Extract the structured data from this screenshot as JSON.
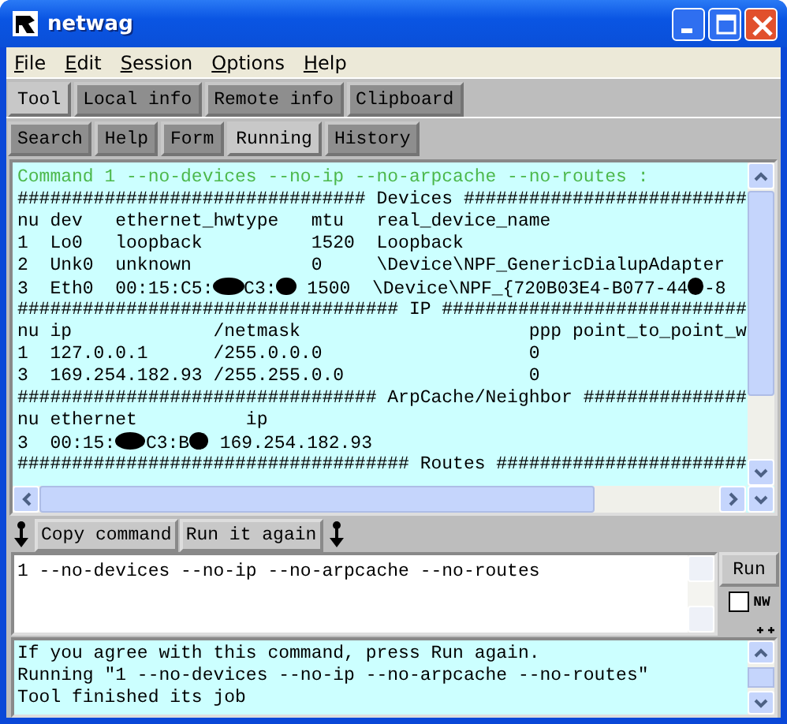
{
  "window": {
    "title": "netwag"
  },
  "menu": [
    {
      "label": "File"
    },
    {
      "label": "Edit"
    },
    {
      "label": "Session"
    },
    {
      "label": "Options"
    },
    {
      "label": "Help"
    }
  ],
  "main_tabs": [
    {
      "label": "Tool",
      "selected": true
    },
    {
      "label": "Local info",
      "selected": false
    },
    {
      "label": "Remote info",
      "selected": false
    },
    {
      "label": "Clipboard",
      "selected": false
    }
  ],
  "tool_tabs": [
    {
      "label": "Search",
      "selected": false
    },
    {
      "label": "Help",
      "selected": false
    },
    {
      "label": "Form",
      "selected": false
    },
    {
      "label": "Running",
      "selected": true
    },
    {
      "label": "History",
      "selected": false
    }
  ],
  "output": [
    {
      "kind": "command",
      "segments": [
        {
          "text": "Command 1 --no-devices --no-ip --no-arpcache --no-routes :"
        }
      ]
    },
    {
      "kind": "plain",
      "segments": [
        {
          "text": "################################ Devices ##########################"
        }
      ]
    },
    {
      "kind": "plain",
      "segments": [
        {
          "text": "nu dev   ethernet_hwtype   mtu   real_device_name"
        }
      ]
    },
    {
      "kind": "plain",
      "segments": [
        {
          "text": "1  Lo0   loopback          1520  Loopback"
        }
      ]
    },
    {
      "kind": "plain",
      "segments": [
        {
          "text": "2  Unk0  unknown           0     \\Device\\NPF_GenericDialupAdapter"
        }
      ]
    },
    {
      "kind": "plain",
      "segments": [
        {
          "text": "3  Eth0  00:15:C5:"
        },
        {
          "kind": "redaction"
        },
        {
          "text": "C3:"
        },
        {
          "kind": "redaction"
        },
        {
          "text": " 1500  \\Device\\NPF_{720B03E4-B077-44"
        },
        {
          "kind": "redaction"
        },
        {
          "text": "-8"
        }
      ]
    },
    {
      "kind": "plain",
      "segments": [
        {
          "text": "################################### IP ############################"
        }
      ]
    },
    {
      "kind": "plain",
      "segments": [
        {
          "text": "nu ip             /netmask                     ppp point_to_point_w"
        }
      ]
    },
    {
      "kind": "plain",
      "segments": [
        {
          "text": "1  127.0.0.1      /255.0.0.0                   0"
        }
      ]
    },
    {
      "kind": "plain",
      "segments": [
        {
          "text": "3  169.254.182.93 /255.255.0.0                 0"
        }
      ]
    },
    {
      "kind": "plain",
      "segments": [
        {
          "text": "################################# ArpCache/Neighbor ###############"
        }
      ]
    },
    {
      "kind": "plain",
      "segments": [
        {
          "text": "nu ethernet          ip"
        }
      ]
    },
    {
      "kind": "plain",
      "segments": [
        {
          "text": "3  00:15:"
        },
        {
          "kind": "redaction"
        },
        {
          "text": "C3:B"
        },
        {
          "kind": "redaction"
        },
        {
          "text": " 169.254.182.93"
        }
      ]
    },
    {
      "kind": "plain",
      "segments": [
        {
          "text": "#################################### Routes #######################"
        }
      ]
    }
  ],
  "action_buttons": [
    "Copy command",
    "Run it again"
  ],
  "command_field": {
    "value": "1 --no-devices --no-ip --no-arpcache --no-routes"
  },
  "run_button": "Run",
  "nw_checkbox": {
    "label": "NW",
    "checked": false
  },
  "messages": [
    "If you agree with this command, press Run again.",
    "Running \"1 --no-devices --no-ip --no-arpcache --no-routes\"",
    "Tool finished its job"
  ]
}
